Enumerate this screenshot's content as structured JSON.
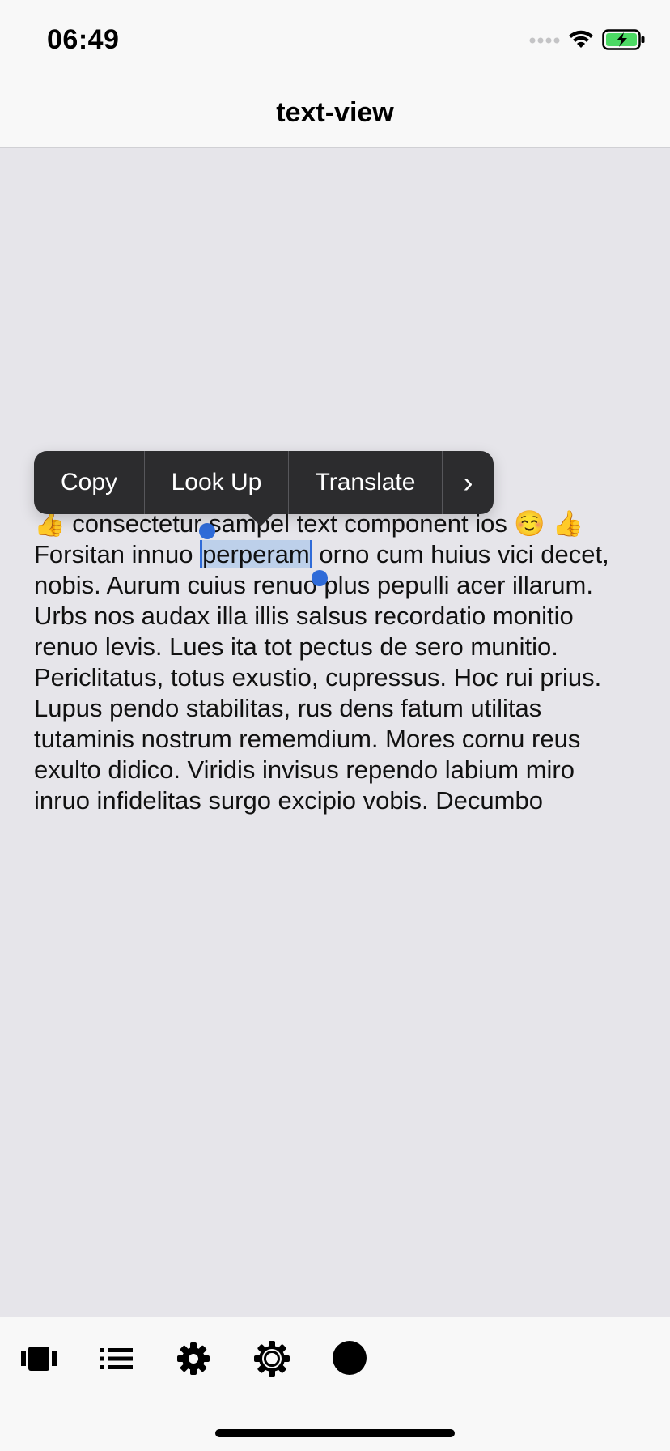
{
  "status_bar": {
    "time": "06:49",
    "icons": [
      "signal-icon",
      "wifi-icon",
      "battery-charging-icon"
    ]
  },
  "nav": {
    "title": "text-view"
  },
  "edit_menu": {
    "items": [
      "Copy",
      "Look Up",
      "Translate",
      "›"
    ]
  },
  "text_view": {
    "lines": [
      "👍 consectetur sampel text component ios ☺️ 👍",
      "Forsitan innuo ",
      "nobis. Aurum cuius renuo plus pepulli acer illarum.",
      "Urbs nos audax illa illis salsus recordatio monitio",
      "renuo levis. Lues ita tot pectus de sero munitio.",
      "Periclitatus, totus exustio, cupressus. Hoc rui prius.",
      "Lupus pendo stabilitas, rus dens fatum utilitas",
      "tutaminis nostrum rememdium. Mores cornu reus",
      "exulto didico. Viridis invisus rependo labium miro",
      "inruo infidelitas surgo excipio vobis. Decumbo"
    ],
    "selected_word": "perperam",
    "line2_after": " orno cum huius vici decet,"
  },
  "tab_bar": {
    "icons": [
      "card-stack-icon",
      "list-icon",
      "gear-icon",
      "gear-outline-icon",
      "circle-icon"
    ]
  },
  "colors": {
    "background": "#e6e5ea",
    "bars": "#f8f8f8",
    "menu": "#2c2c2e",
    "selection": "#bdd0ea",
    "selection_handle": "#2f6bd8",
    "battery": "#4cd964"
  }
}
